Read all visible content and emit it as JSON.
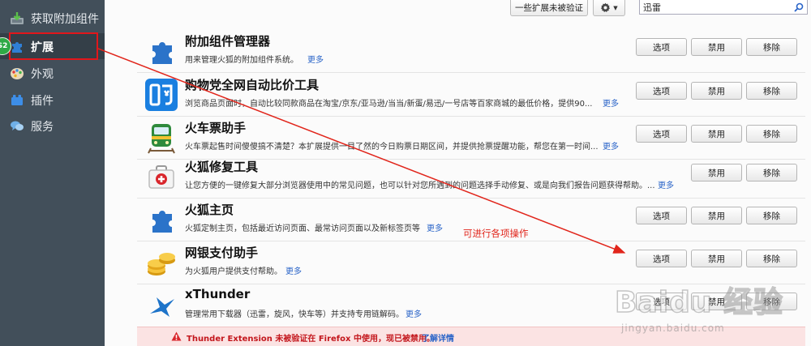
{
  "sidebar": {
    "items": [
      {
        "label": "获取附加组件",
        "icon": "get-addons-icon"
      },
      {
        "label": "扩展",
        "icon": "puzzle-piece-icon",
        "selected": true
      },
      {
        "label": "外观",
        "icon": "palette-icon"
      },
      {
        "label": "插件",
        "icon": "plugin-brick-icon"
      },
      {
        "label": "服务",
        "icon": "speech-bubbles-icon"
      }
    ],
    "step_badge": "S2"
  },
  "toolbar": {
    "unverified_label": "一些扩展未被验证",
    "gear_icon": "gear-icon",
    "search_value": "迅雷",
    "search_icon": "search-icon"
  },
  "addons": [
    {
      "name": "附加组件管理器",
      "desc": "用来管理火狐的附加组件系统。",
      "more": "更多",
      "icon": "puzzle-piece-icon",
      "options": "选项",
      "disable": "禁用",
      "remove": "移除"
    },
    {
      "name": "购物党全网自动比价工具",
      "desc": "浏览商品页面时，自动比较同款商品在淘宝/京东/亚马逊/当当/新蛋/易迅/一号店等百家商城的最低价格，提供90...",
      "more": "更多",
      "icon": "gou-shopping-icon",
      "options": "选项",
      "disable": "禁用",
      "remove": "移除"
    },
    {
      "name": "火车票助手",
      "desc": "火车票起售时间傻傻搞不清楚？本扩展提供一目了然的今日购票日期区间，并提供抢票提醒功能，帮您在第一时间...",
      "more": "更多",
      "icon": "train-icon",
      "options": "选项",
      "disable": "禁用",
      "remove": "移除"
    },
    {
      "name": "火狐修复工具",
      "desc": "让您方便的一键修复大部分浏览器使用中的常见问题，也可以针对您所遇到的问题选择手动修复、或是向我们报告问题获得帮助。...",
      "more": "更多",
      "icon": "first-aid-kit-icon",
      "disable": "禁用",
      "remove": "移除"
    },
    {
      "name": "火狐主页",
      "desc": "火狐定制主页，包括最近访问页面、最常访问页面以及新标签页等",
      "more": "更多",
      "icon": "puzzle-piece-icon",
      "options": "选项",
      "disable": "禁用",
      "remove": "移除"
    },
    {
      "name": "网银支付助手",
      "desc": "为火狐用户提供支付帮助。",
      "more": "更多",
      "icon": "gold-coins-icon",
      "options": "选项",
      "disable": "禁用",
      "remove": "移除"
    },
    {
      "name": "xThunder",
      "desc": "管理常用下载器（迅雷，旋风，快车等）并支持专用链解码。",
      "more": "更多",
      "icon": "thunder-bird-icon",
      "options": "选项",
      "disable": "禁用",
      "remove": "移除"
    }
  ],
  "warning": {
    "text": "Thunder Extension 未被验证在 Firefox 中使用，现已被禁用。",
    "link": "了解详情",
    "icon": "warning-triangle-icon"
  },
  "annotation": "可进行各项操作",
  "watermark": {
    "main": "Baidu 经验",
    "sub": "jingyan.baidu.com"
  },
  "colors": {
    "sidebar_bg": "#424f5a",
    "accent_red": "#e2161b",
    "link_blue": "#2a64c8",
    "warning_text": "#c3161c"
  }
}
